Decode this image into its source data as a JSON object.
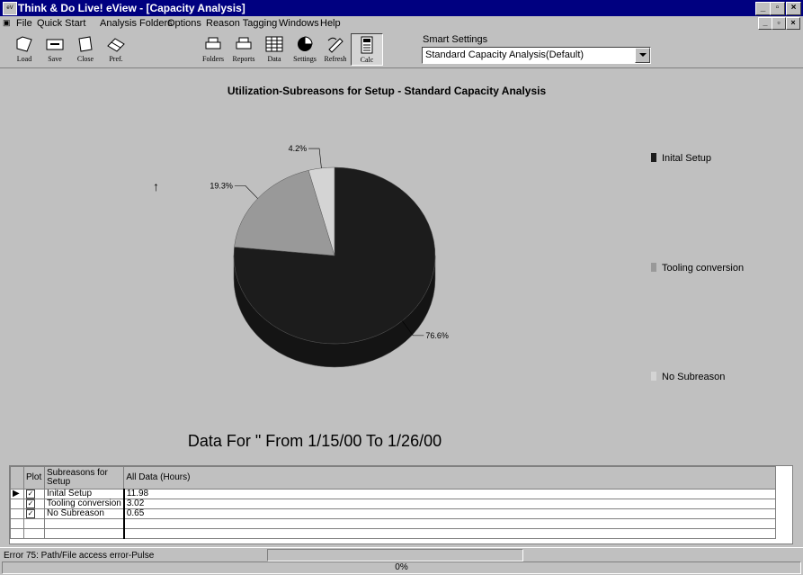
{
  "window": {
    "title": "Think & Do Live! eView - [Capacity Analysis]"
  },
  "menu": [
    "File",
    "Quick Start",
    "Analysis Folders",
    "Options",
    "Reason Tagging",
    "Windows",
    "Help"
  ],
  "toolbar": {
    "buttons": [
      "Load",
      "Save",
      "Close",
      "Pref.",
      "Folders",
      "Reports",
      "Data",
      "Settings",
      "Refresh",
      "Calc"
    ],
    "smart_settings_label": "Smart Settings",
    "smart_settings_value": "Standard Capacity Analysis(Default)"
  },
  "chart_data": {
    "type": "pie",
    "title": "Utilization-Subreasons for Setup - Standard Capacity Analysis",
    "slices": [
      {
        "name": "Inital Setup",
        "value": 11.98,
        "label": "76.6%",
        "color": "#1c1c1c"
      },
      {
        "name": "Tooling conversion",
        "value": 3.02,
        "label": "19.3%",
        "color": "#999999"
      },
      {
        "name": "No Subreason",
        "value": 0.65,
        "label": "4.2%",
        "color": "#d4d4d4"
      }
    ]
  },
  "date_range": "Data For \" From 1/15/00 To 1/26/00",
  "grid": {
    "headers": [
      "Plot",
      "Subreasons for Setup",
      "All Data (Hours)"
    ],
    "rows": [
      {
        "plot": true,
        "name": "Inital Setup",
        "hours": "11.98"
      },
      {
        "plot": true,
        "name": "Tooling conversion",
        "hours": "3.02"
      },
      {
        "plot": true,
        "name": "No Subreason",
        "hours": "0.65"
      }
    ]
  },
  "status": {
    "message": "Error 75: Path/File access error-Pulse",
    "progress": "0%"
  }
}
